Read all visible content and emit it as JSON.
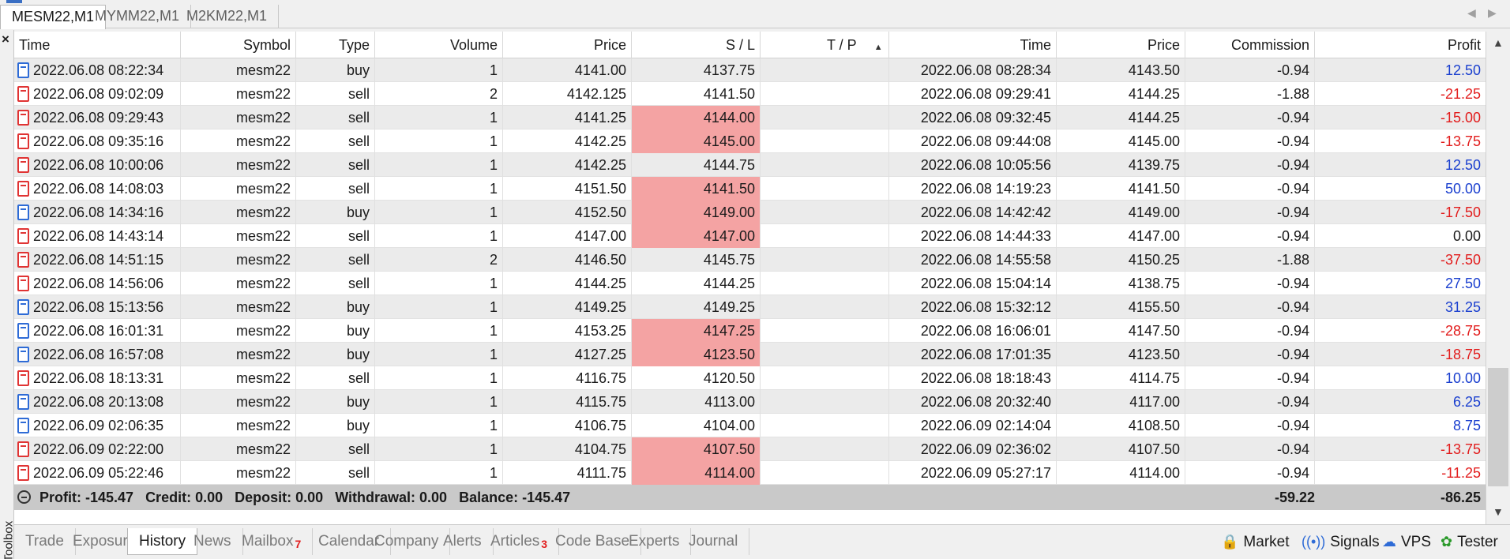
{
  "chart_tabs": [
    {
      "label": "MESM22,M1",
      "active": true
    },
    {
      "label": "MYMM22,M1",
      "active": false
    },
    {
      "label": "M2KM22,M1",
      "active": false
    }
  ],
  "toolbox": {
    "label": "Toolbox",
    "close_glyph": "×"
  },
  "columns": [
    "Time",
    "Symbol",
    "Type",
    "Volume",
    "Price",
    "S / L",
    "T / P",
    "Time",
    "Price",
    "Commission",
    "Profit"
  ],
  "sort_indicator": "▲",
  "rows": [
    {
      "open_time": "2022.06.08 08:22:34",
      "symbol": "mesm22",
      "type": "buy",
      "volume": "1",
      "price": "4141.00",
      "sl": "4137.75",
      "sl_hit": false,
      "tp": "",
      "close_time": "2022.06.08 08:28:34",
      "close_price": "4143.50",
      "commission": "-0.94",
      "profit": "12.50"
    },
    {
      "open_time": "2022.06.08 09:02:09",
      "symbol": "mesm22",
      "type": "sell",
      "volume": "2",
      "price": "4142.125",
      "sl": "4141.50",
      "sl_hit": false,
      "tp": "",
      "close_time": "2022.06.08 09:29:41",
      "close_price": "4144.25",
      "commission": "-1.88",
      "profit": "-21.25"
    },
    {
      "open_time": "2022.06.08 09:29:43",
      "symbol": "mesm22",
      "type": "sell",
      "volume": "1",
      "price": "4141.25",
      "sl": "4144.00",
      "sl_hit": true,
      "tp": "",
      "close_time": "2022.06.08 09:32:45",
      "close_price": "4144.25",
      "commission": "-0.94",
      "profit": "-15.00"
    },
    {
      "open_time": "2022.06.08 09:35:16",
      "symbol": "mesm22",
      "type": "sell",
      "volume": "1",
      "price": "4142.25",
      "sl": "4145.00",
      "sl_hit": true,
      "tp": "",
      "close_time": "2022.06.08 09:44:08",
      "close_price": "4145.00",
      "commission": "-0.94",
      "profit": "-13.75"
    },
    {
      "open_time": "2022.06.08 10:00:06",
      "symbol": "mesm22",
      "type": "sell",
      "volume": "1",
      "price": "4142.25",
      "sl": "4144.75",
      "sl_hit": false,
      "tp": "",
      "close_time": "2022.06.08 10:05:56",
      "close_price": "4139.75",
      "commission": "-0.94",
      "profit": "12.50"
    },
    {
      "open_time": "2022.06.08 14:08:03",
      "symbol": "mesm22",
      "type": "sell",
      "volume": "1",
      "price": "4151.50",
      "sl": "4141.50",
      "sl_hit": true,
      "tp": "",
      "close_time": "2022.06.08 14:19:23",
      "close_price": "4141.50",
      "commission": "-0.94",
      "profit": "50.00"
    },
    {
      "open_time": "2022.06.08 14:34:16",
      "symbol": "mesm22",
      "type": "buy",
      "volume": "1",
      "price": "4152.50",
      "sl": "4149.00",
      "sl_hit": true,
      "tp": "",
      "close_time": "2022.06.08 14:42:42",
      "close_price": "4149.00",
      "commission": "-0.94",
      "profit": "-17.50"
    },
    {
      "open_time": "2022.06.08 14:43:14",
      "symbol": "mesm22",
      "type": "sell",
      "volume": "1",
      "price": "4147.00",
      "sl": "4147.00",
      "sl_hit": true,
      "tp": "",
      "close_time": "2022.06.08 14:44:33",
      "close_price": "4147.00",
      "commission": "-0.94",
      "profit": "0.00"
    },
    {
      "open_time": "2022.06.08 14:51:15",
      "symbol": "mesm22",
      "type": "sell",
      "volume": "2",
      "price": "4146.50",
      "sl": "4145.75",
      "sl_hit": false,
      "tp": "",
      "close_time": "2022.06.08 14:55:58",
      "close_price": "4150.25",
      "commission": "-1.88",
      "profit": "-37.50"
    },
    {
      "open_time": "2022.06.08 14:56:06",
      "symbol": "mesm22",
      "type": "sell",
      "volume": "1",
      "price": "4144.25",
      "sl": "4144.25",
      "sl_hit": false,
      "tp": "",
      "close_time": "2022.06.08 15:04:14",
      "close_price": "4138.75",
      "commission": "-0.94",
      "profit": "27.50"
    },
    {
      "open_time": "2022.06.08 15:13:56",
      "symbol": "mesm22",
      "type": "buy",
      "volume": "1",
      "price": "4149.25",
      "sl": "4149.25",
      "sl_hit": false,
      "tp": "",
      "close_time": "2022.06.08 15:32:12",
      "close_price": "4155.50",
      "commission": "-0.94",
      "profit": "31.25"
    },
    {
      "open_time": "2022.06.08 16:01:31",
      "symbol": "mesm22",
      "type": "buy",
      "volume": "1",
      "price": "4153.25",
      "sl": "4147.25",
      "sl_hit": true,
      "tp": "",
      "close_time": "2022.06.08 16:06:01",
      "close_price": "4147.50",
      "commission": "-0.94",
      "profit": "-28.75"
    },
    {
      "open_time": "2022.06.08 16:57:08",
      "symbol": "mesm22",
      "type": "buy",
      "volume": "1",
      "price": "4127.25",
      "sl": "4123.50",
      "sl_hit": true,
      "tp": "",
      "close_time": "2022.06.08 17:01:35",
      "close_price": "4123.50",
      "commission": "-0.94",
      "profit": "-18.75"
    },
    {
      "open_time": "2022.06.08 18:13:31",
      "symbol": "mesm22",
      "type": "sell",
      "volume": "1",
      "price": "4116.75",
      "sl": "4120.50",
      "sl_hit": false,
      "tp": "",
      "close_time": "2022.06.08 18:18:43",
      "close_price": "4114.75",
      "commission": "-0.94",
      "profit": "10.00"
    },
    {
      "open_time": "2022.06.08 20:13:08",
      "symbol": "mesm22",
      "type": "buy",
      "volume": "1",
      "price": "4115.75",
      "sl": "4113.00",
      "sl_hit": false,
      "tp": "",
      "close_time": "2022.06.08 20:32:40",
      "close_price": "4117.00",
      "commission": "-0.94",
      "profit": "6.25"
    },
    {
      "open_time": "2022.06.09 02:06:35",
      "symbol": "mesm22",
      "type": "buy",
      "volume": "1",
      "price": "4106.75",
      "sl": "4104.00",
      "sl_hit": false,
      "tp": "",
      "close_time": "2022.06.09 02:14:04",
      "close_price": "4108.50",
      "commission": "-0.94",
      "profit": "8.75"
    },
    {
      "open_time": "2022.06.09 02:22:00",
      "symbol": "mesm22",
      "type": "sell",
      "volume": "1",
      "price": "4104.75",
      "sl": "4107.50",
      "sl_hit": true,
      "tp": "",
      "close_time": "2022.06.09 02:36:02",
      "close_price": "4107.50",
      "commission": "-0.94",
      "profit": "-13.75"
    },
    {
      "open_time": "2022.06.09 05:22:46",
      "symbol": "mesm22",
      "type": "sell",
      "volume": "1",
      "price": "4111.75",
      "sl": "4114.00",
      "sl_hit": true,
      "tp": "",
      "close_time": "2022.06.09 05:27:17",
      "close_price": "4114.00",
      "commission": "-0.94",
      "profit": "-11.25"
    }
  ],
  "summary": {
    "profit": "Profit: -145.47",
    "credit": "Credit: 0.00",
    "deposit": "Deposit: 0.00",
    "withdrawal": "Withdrawal: 0.00",
    "balance": "Balance: -145.47",
    "commission_total": "-59.22",
    "profit_total": "-86.25"
  },
  "bottom_tabs": [
    {
      "label": "Trade",
      "badge": "",
      "active": false
    },
    {
      "label": "Exposure",
      "badge": "",
      "active": false
    },
    {
      "label": "History",
      "badge": "",
      "active": true
    },
    {
      "label": "News",
      "badge": "",
      "active": false
    },
    {
      "label": "Mailbox",
      "badge": "7",
      "active": false
    },
    {
      "label": "Calendar",
      "badge": "",
      "active": false
    },
    {
      "label": "Company",
      "badge": "",
      "active": false
    },
    {
      "label": "Alerts",
      "badge": "",
      "active": false
    },
    {
      "label": "Articles",
      "badge": "3",
      "active": false
    },
    {
      "label": "Code Base",
      "badge": "",
      "active": false
    },
    {
      "label": "Experts",
      "badge": "",
      "active": false
    },
    {
      "label": "Journal",
      "badge": "",
      "active": false
    }
  ],
  "right_tools": [
    {
      "label": "Market",
      "icon": "shopping-bag-icon"
    },
    {
      "label": "Signals",
      "icon": "signal-icon"
    },
    {
      "label": "VPS",
      "icon": "cloud-icon"
    },
    {
      "label": "Tester",
      "icon": "tester-icon"
    }
  ],
  "colors": {
    "profit_positive": "#1a3fcf",
    "profit_negative": "#e21c1c",
    "sl_highlight": "#f4a3a3",
    "summary_bg": "#c9c9c9"
  }
}
